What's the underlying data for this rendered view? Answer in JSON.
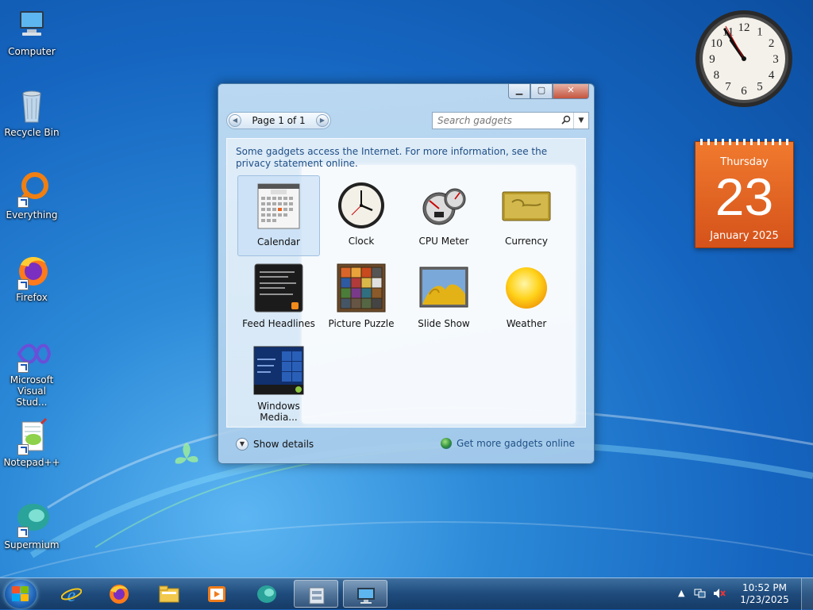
{
  "desktop": {
    "icons": [
      {
        "label": "Computer",
        "icon": "computer-icon"
      },
      {
        "label": "Recycle Bin",
        "icon": "recycle-bin-icon"
      },
      {
        "label": "Everything",
        "icon": "everything-icon"
      },
      {
        "label": "Firefox",
        "icon": "firefox-icon"
      },
      {
        "label": "Microsoft Visual Stud...",
        "icon": "visual-studio-icon"
      },
      {
        "label": "Notepad++",
        "icon": "notepad-plus-plus-icon"
      },
      {
        "label": "Supermium",
        "icon": "supermium-icon"
      }
    ]
  },
  "gadget_window": {
    "controls": {
      "minimize": "▁",
      "maximize": "▢",
      "close": "✕"
    },
    "pager": {
      "text": "Page 1 of 1",
      "prev": "◀",
      "next": "▶"
    },
    "search": {
      "placeholder": "Search gadgets",
      "icon": "search-icon"
    },
    "privacy_notice": "Some gadgets access the Internet.  For more information, see the privacy statement online.",
    "gadgets": [
      {
        "name": "Calendar",
        "icon": "calendar-gadget-icon",
        "selected": true
      },
      {
        "name": "Clock",
        "icon": "clock-gadget-icon"
      },
      {
        "name": "CPU Meter",
        "icon": "cpu-meter-gadget-icon"
      },
      {
        "name": "Currency",
        "icon": "currency-gadget-icon"
      },
      {
        "name": "Feed Headlines",
        "icon": "feed-headlines-gadget-icon"
      },
      {
        "name": "Picture Puzzle",
        "icon": "picture-puzzle-gadget-icon"
      },
      {
        "name": "Slide Show",
        "icon": "slide-show-gadget-icon"
      },
      {
        "name": "Weather",
        "icon": "weather-gadget-icon"
      },
      {
        "name": "Windows Media...",
        "icon": "windows-media-gadget-icon"
      }
    ],
    "show_details": "Show details",
    "get_more": "Get more gadgets online"
  },
  "desktop_gadgets": {
    "calendar": {
      "weekday": "Thursday",
      "day": "23",
      "month_year": "January 2025"
    },
    "clock": {
      "numerals": [
        "12",
        "1",
        "2",
        "3",
        "4",
        "5",
        "6",
        "7",
        "8",
        "9",
        "10",
        "11"
      ]
    }
  },
  "taskbar": {
    "items": [
      {
        "icon": "internet-explorer-icon"
      },
      {
        "icon": "firefox-icon"
      },
      {
        "icon": "file-explorer-icon"
      },
      {
        "icon": "media-player-icon"
      },
      {
        "icon": "supermium-icon"
      },
      {
        "icon": "control-panel-icon"
      },
      {
        "icon": "gadgets-icon",
        "active": true
      }
    ],
    "clock": {
      "time": "10:52 PM",
      "date": "1/23/2025"
    }
  },
  "colors": {
    "accent": "#1565c0",
    "calendar_orange": "#e8641f"
  }
}
